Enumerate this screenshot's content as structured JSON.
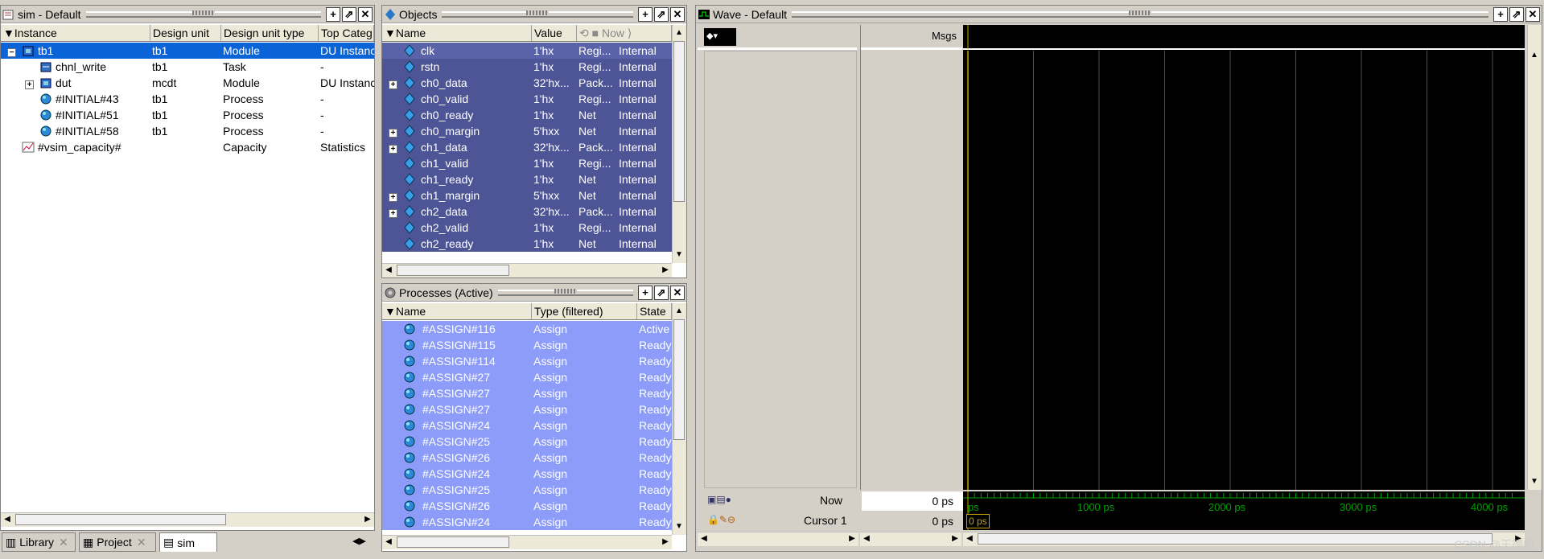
{
  "sim_pane": {
    "title": "sim - Default",
    "columns": [
      "Instance",
      "Design unit",
      "Design unit type",
      "Top Categ"
    ],
    "rows": [
      {
        "expander": "−",
        "icon": "module-icon",
        "instance": "tb1",
        "design_unit": "tb1",
        "type": "Module",
        "top": "DU Instanc",
        "selected": true,
        "indent": 0
      },
      {
        "expander": "",
        "icon": "task-icon",
        "instance": "chnl_write",
        "design_unit": "tb1",
        "type": "Task",
        "top": "-",
        "indent": 1
      },
      {
        "expander": "+",
        "icon": "module-icon",
        "instance": "dut",
        "design_unit": "mcdt",
        "type": "Module",
        "top": "DU Instanc",
        "indent": 1
      },
      {
        "expander": "",
        "icon": "process-icon",
        "instance": "#INITIAL#43",
        "design_unit": "tb1",
        "type": "Process",
        "top": "-",
        "indent": 1
      },
      {
        "expander": "",
        "icon": "process-icon",
        "instance": "#INITIAL#51",
        "design_unit": "tb1",
        "type": "Process",
        "top": "-",
        "indent": 1
      },
      {
        "expander": "",
        "icon": "process-icon",
        "instance": "#INITIAL#58",
        "design_unit": "tb1",
        "type": "Process",
        "top": "-",
        "indent": 1
      },
      {
        "expander": "",
        "icon": "capacity-icon",
        "instance": "#vsim_capacity#",
        "design_unit": "",
        "type": "Capacity",
        "top": "Statistics",
        "indent": 0
      }
    ],
    "tabs": [
      "Library",
      "Project",
      "sim"
    ]
  },
  "objects_pane": {
    "title": "Objects",
    "columns": [
      "Name",
      "Value",
      "Now"
    ],
    "rows": [
      {
        "expander": "",
        "name": "clk",
        "value": "1'hx",
        "kind": "Regi...",
        "mode": "Internal",
        "highlight": true
      },
      {
        "expander": "",
        "name": "rstn",
        "value": "1'hx",
        "kind": "Regi...",
        "mode": "Internal"
      },
      {
        "expander": "+",
        "name": "ch0_data",
        "value": "32'hx...",
        "kind": "Pack...",
        "mode": "Internal"
      },
      {
        "expander": "",
        "name": "ch0_valid",
        "value": "1'hx",
        "kind": "Regi...",
        "mode": "Internal"
      },
      {
        "expander": "",
        "name": "ch0_ready",
        "value": "1'hx",
        "kind": "Net",
        "mode": "Internal"
      },
      {
        "expander": "+",
        "name": "ch0_margin",
        "value": "5'hxx",
        "kind": "Net",
        "mode": "Internal"
      },
      {
        "expander": "+",
        "name": "ch1_data",
        "value": "32'hx...",
        "kind": "Pack...",
        "mode": "Internal"
      },
      {
        "expander": "",
        "name": "ch1_valid",
        "value": "1'hx",
        "kind": "Regi...",
        "mode": "Internal"
      },
      {
        "expander": "",
        "name": "ch1_ready",
        "value": "1'hx",
        "kind": "Net",
        "mode": "Internal"
      },
      {
        "expander": "+",
        "name": "ch1_margin",
        "value": "5'hxx",
        "kind": "Net",
        "mode": "Internal"
      },
      {
        "expander": "+",
        "name": "ch2_data",
        "value": "32'hx...",
        "kind": "Pack...",
        "mode": "Internal"
      },
      {
        "expander": "",
        "name": "ch2_valid",
        "value": "1'hx",
        "kind": "Regi...",
        "mode": "Internal"
      },
      {
        "expander": "",
        "name": "ch2_ready",
        "value": "1'hx",
        "kind": "Net",
        "mode": "Internal"
      }
    ]
  },
  "processes_pane": {
    "title": "Processes (Active)",
    "columns": [
      "Name",
      "Type (filtered)",
      "State"
    ],
    "rows": [
      {
        "name": "#ASSIGN#116",
        "type": "Assign",
        "state": "Active"
      },
      {
        "name": "#ASSIGN#115",
        "type": "Assign",
        "state": "Ready"
      },
      {
        "name": "#ASSIGN#114",
        "type": "Assign",
        "state": "Ready"
      },
      {
        "name": "#ASSIGN#27",
        "type": "Assign",
        "state": "Ready"
      },
      {
        "name": "#ASSIGN#27",
        "type": "Assign",
        "state": "Ready"
      },
      {
        "name": "#ASSIGN#27",
        "type": "Assign",
        "state": "Ready"
      },
      {
        "name": "#ASSIGN#24",
        "type": "Assign",
        "state": "Ready"
      },
      {
        "name": "#ASSIGN#25",
        "type": "Assign",
        "state": "Ready"
      },
      {
        "name": "#ASSIGN#26",
        "type": "Assign",
        "state": "Ready"
      },
      {
        "name": "#ASSIGN#24",
        "type": "Assign",
        "state": "Ready"
      },
      {
        "name": "#ASSIGN#25",
        "type": "Assign",
        "state": "Ready"
      },
      {
        "name": "#ASSIGN#26",
        "type": "Assign",
        "state": "Ready"
      },
      {
        "name": "#ASSIGN#24",
        "type": "Assign",
        "state": "Ready"
      }
    ]
  },
  "wave_pane": {
    "title": "Wave - Default",
    "msgs_label": "Msgs",
    "now_label": "Now",
    "now_value": "0 ps",
    "cursor_label": "Cursor 1",
    "cursor_value": "0 ps",
    "cursor_marker": "0 ps",
    "timeline_labels": [
      "ps",
      "1000 ps",
      "2000 ps",
      "3000 ps",
      "4000 ps"
    ],
    "colors": {
      "background": "#000000",
      "grid": "#404040",
      "cursor": "#c8a000",
      "timeline": "#00a000"
    }
  },
  "watermark": "CSDN @王德彪"
}
